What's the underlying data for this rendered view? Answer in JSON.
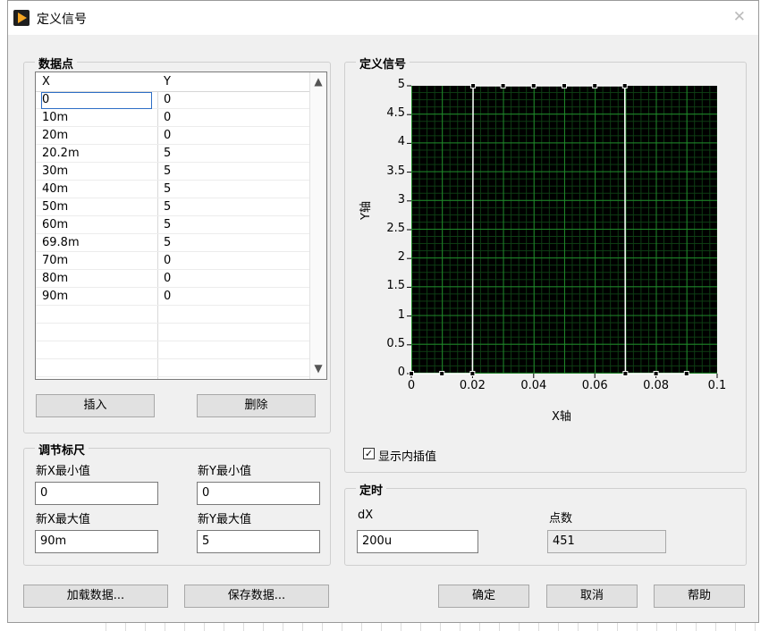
{
  "window": {
    "title": "定义信号",
    "close_glyph": "✕"
  },
  "data_points": {
    "legend": "数据点",
    "headers": [
      "X",
      "Y"
    ],
    "rows": [
      {
        "x": "0",
        "y": "0"
      },
      {
        "x": "10m",
        "y": "0"
      },
      {
        "x": "20m",
        "y": "0"
      },
      {
        "x": "20.2m",
        "y": "5"
      },
      {
        "x": "30m",
        "y": "5"
      },
      {
        "x": "40m",
        "y": "5"
      },
      {
        "x": "50m",
        "y": "5"
      },
      {
        "x": "60m",
        "y": "5"
      },
      {
        "x": "69.8m",
        "y": "5"
      },
      {
        "x": "70m",
        "y": "0"
      },
      {
        "x": "80m",
        "y": "0"
      },
      {
        "x": "90m",
        "y": "0"
      }
    ],
    "empty_rows": 4,
    "scroll_up": "▲",
    "scroll_down": "▼",
    "insert_label": "插入",
    "delete_label": "删除"
  },
  "scale": {
    "legend": "调节标尺",
    "new_x_min_label": "新X最小值",
    "new_x_min": "0",
    "new_y_min_label": "新Y最小值",
    "new_y_min": "0",
    "new_x_max_label": "新X最大值",
    "new_x_max": "90m",
    "new_y_max_label": "新Y最大值",
    "new_y_max": "5"
  },
  "signal": {
    "legend": "定义信号",
    "show_interp_label": "显示内插值",
    "show_interp_checked": true,
    "check_glyph": "✓"
  },
  "timing": {
    "legend": "定时",
    "dx_label": "dX",
    "dx_value": "200u",
    "points_label": "点数",
    "points_value": "451"
  },
  "buttons": {
    "load": "加载数据...",
    "save": "保存数据...",
    "ok": "确定",
    "cancel": "取消",
    "help": "帮助"
  },
  "chart_data": {
    "type": "line",
    "xlabel": "X轴",
    "ylabel": "Y轴",
    "xlim": [
      0,
      0.1
    ],
    "ylim": [
      0,
      5
    ],
    "x_ticks": [
      "0",
      "0.02",
      "0.04",
      "0.06",
      "0.08",
      "0.1"
    ],
    "y_ticks": [
      "0",
      "0.5",
      "1",
      "1.5",
      "2",
      "2.5",
      "3",
      "3.5",
      "4",
      "4.5",
      "5"
    ],
    "grid": true,
    "background": "#000000",
    "grid_color": "#1f8a2a",
    "line_color": "#ffffff",
    "series": [
      {
        "x": [
          0,
          0.01,
          0.02,
          0.0202,
          0.03,
          0.04,
          0.05,
          0.06,
          0.0698,
          0.07,
          0.08,
          0.09
        ],
        "y": [
          0,
          0,
          0,
          5,
          5,
          5,
          5,
          5,
          5,
          0,
          0,
          0
        ]
      }
    ]
  }
}
